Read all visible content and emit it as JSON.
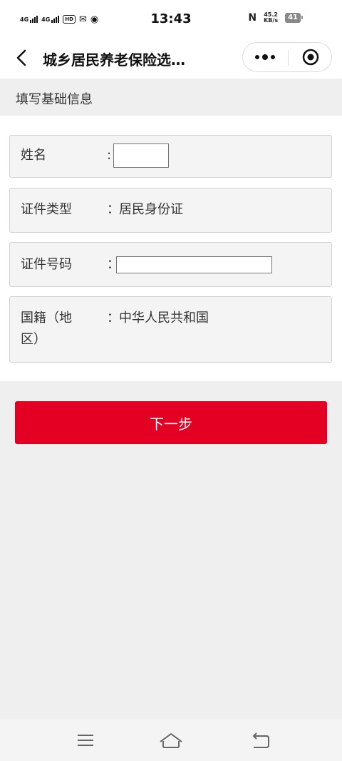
{
  "status_bar": {
    "time": "13:43",
    "signal1_label": "4G",
    "signal2_label": "4G",
    "hd_label": "HD",
    "speed_value": "45.2",
    "speed_unit": "KB/s",
    "battery": "41"
  },
  "nav": {
    "title": "城乡居民养老保险选…"
  },
  "section": {
    "title": "填写基础信息"
  },
  "form": {
    "name": {
      "label": "姓名",
      "colon": ":",
      "value": ""
    },
    "id_type": {
      "label": "证件类型",
      "colon": "：",
      "value": "居民身份证"
    },
    "id_number": {
      "label": "证件号码",
      "colon": "：",
      "value": ""
    },
    "nationality": {
      "label_line1": "国籍（地",
      "label_line2": "区）",
      "colon": "：",
      "value": "中华人民共和国"
    }
  },
  "next_button": {
    "label": "下一步"
  },
  "colors": {
    "accent": "#e30022",
    "page_bg": "#efefef",
    "row_bg": "#f4f4f4"
  }
}
